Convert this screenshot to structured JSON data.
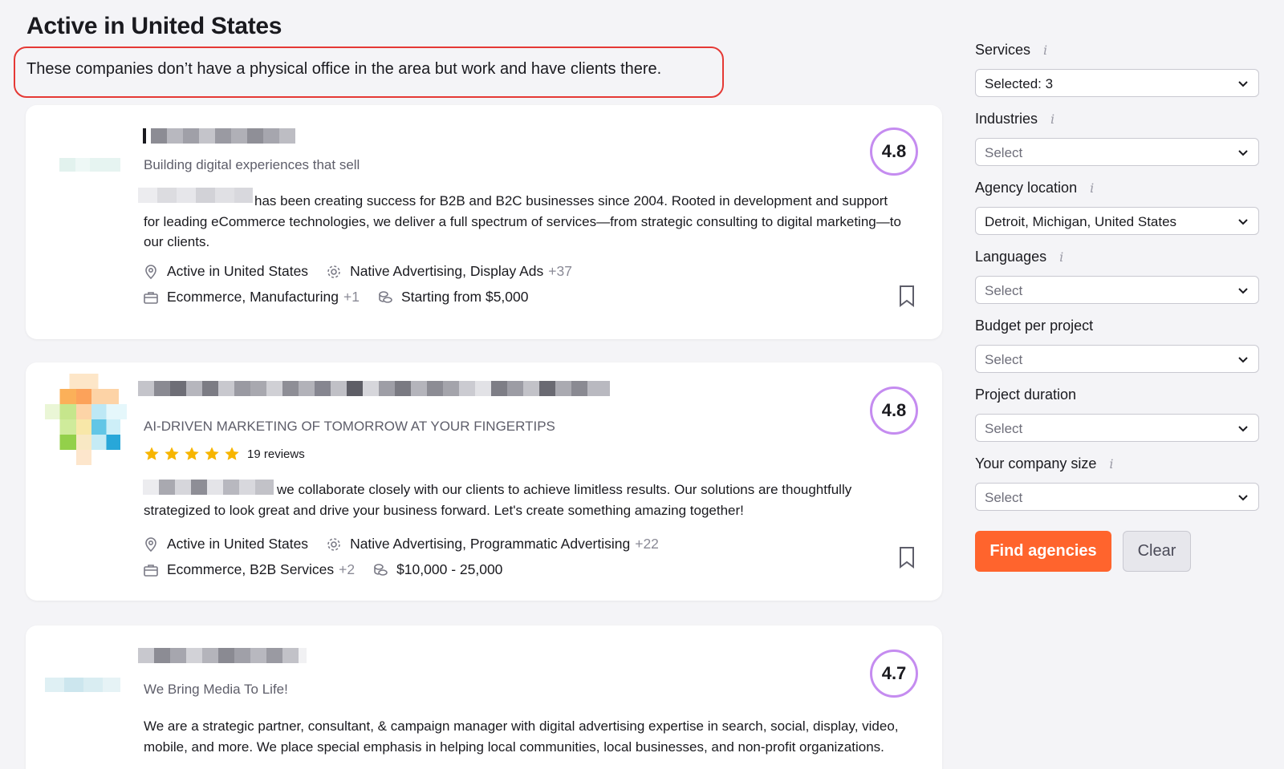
{
  "page": {
    "title": "Active in United States",
    "notice": "These companies don’t have a physical office in the area but work and have clients there."
  },
  "agencies": [
    {
      "tagline": "Building digital experiences that sell",
      "rating": "4.8",
      "description": "has been creating success for B2B and B2C businesses since 2004. Rooted in development and support for leading eCommerce technologies, we deliver a full spectrum of services—from strategic consulting to digital marketing—to our clients.",
      "location": "Active in United States",
      "services": "Native Advertising, Display Ads",
      "services_more": "+37",
      "industries": "Ecommerce, Manufacturing",
      "industries_more": "+1",
      "budget": "Starting from $5,000"
    },
    {
      "tagline": "AI-DRIVEN MARKETING OF TOMORROW AT YOUR FINGERTIPS",
      "rating": "4.8",
      "reviews": "19 reviews",
      "stars": 5,
      "description": "we collaborate closely with our clients to achieve limitless results. Our solutions are thoughtfully strategized to look great and drive your business forward. Let's create something amazing together!",
      "location": "Active in United States",
      "services": "Native Advertising, Programmatic Advertising",
      "services_more": "+22",
      "industries": "Ecommerce, B2B Services",
      "industries_more": "+2",
      "budget": "$10,000 - 25,000"
    },
    {
      "tagline": "We Bring Media To Life!",
      "rating": "4.7",
      "description": "We are a strategic partner, consultant, & campaign manager with digital advertising expertise in search, social, display, video, mobile, and more. We place special emphasis in helping local communities, local businesses, and non-profit organizations."
    }
  ],
  "filters": {
    "services": {
      "label": "Services",
      "info": "i",
      "value": "Selected: 3"
    },
    "industries": {
      "label": "Industries",
      "info": "i",
      "value": "Select"
    },
    "location": {
      "label": "Agency location",
      "info": "i",
      "value": "Detroit, Michigan, United States"
    },
    "languages": {
      "label": "Languages",
      "info": "i",
      "value": "Select"
    },
    "budget": {
      "label": "Budget per project",
      "value": "Select"
    },
    "duration": {
      "label": "Project duration",
      "value": "Select"
    },
    "size": {
      "label": "Your company size",
      "info": "i",
      "value": "Select"
    },
    "find_label": "Find agencies",
    "clear_label": "Clear"
  },
  "colors": {
    "accent": "#ff642d",
    "rating_ring": "#c58cf0",
    "notice_border": "#e53935",
    "star": "#f7b500"
  }
}
